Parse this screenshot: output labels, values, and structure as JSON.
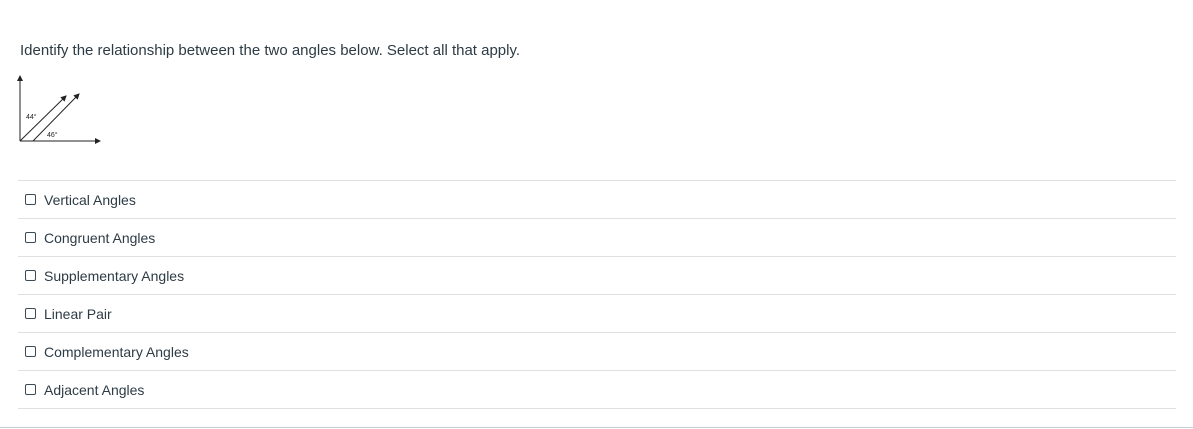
{
  "question": {
    "prompt": "Identify the relationship between the two angles below. Select all that apply.",
    "figure": {
      "angle_upper_label": "44°",
      "angle_lower_label": "46°"
    }
  },
  "answers": [
    {
      "label": "Vertical Angles",
      "checked": false
    },
    {
      "label": "Congruent Angles",
      "checked": false
    },
    {
      "label": "Supplementary Angles",
      "checked": false
    },
    {
      "label": "Linear Pair",
      "checked": false
    },
    {
      "label": "Complementary Angles",
      "checked": false
    },
    {
      "label": "Adjacent Angles",
      "checked": false
    }
  ]
}
